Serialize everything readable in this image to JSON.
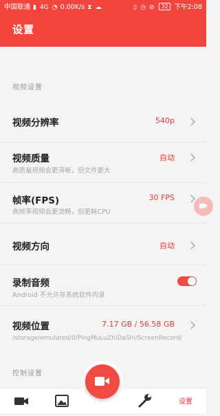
{
  "status_bar": {
    "carrier": "中国联通",
    "network": "4G",
    "speed": "0.00K/s",
    "battery": "32",
    "time": "下午2:08"
  },
  "app_bar": {
    "title": "设置"
  },
  "sections": {
    "video": {
      "header": "视频设置"
    },
    "control": {
      "header": "控制设置"
    }
  },
  "settings": {
    "resolution": {
      "title": "视频分辨率",
      "value": "540p"
    },
    "quality": {
      "title": "视频质量",
      "subtitle": "高质量视频会更清晰，但文件更大",
      "value": "自动"
    },
    "fps": {
      "title": "帧率(FPS)",
      "subtitle": "高帧率视频会更流畅，但更耗CPU",
      "value": "30 FPS"
    },
    "orientation": {
      "title": "视频方向",
      "value": "自动"
    },
    "audio": {
      "title": "录制音频",
      "subtitle": "Android 不允许非系统软件内录",
      "enabled": true
    },
    "location": {
      "title": "视频位置",
      "value": "7.17 GB / 56.58 GB",
      "path": "/storage/emulated/0/PingMuLuZhiDaShi/ScreenRecord/"
    }
  },
  "bottom_nav": {
    "settings_label": "设置"
  },
  "colors": {
    "accent": "#f2453d",
    "value_red": "#e53935"
  }
}
